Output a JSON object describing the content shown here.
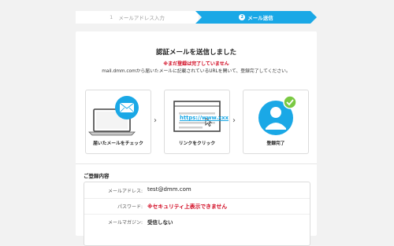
{
  "stepper": {
    "step1_number": "1",
    "step1_label": "メールアドレス入力",
    "step2_number": "2",
    "step2_label": "メール送信"
  },
  "main": {
    "title": "認証メールを送信しました",
    "warning": "※まだ登録は完了していません",
    "description": "mail.dmm.comから届いたメールに記載されているURLを開いて、登録完了してください。"
  },
  "steps": [
    {
      "caption": "届いたメールをチェック",
      "icon": "laptop-mail-icon"
    },
    {
      "caption": "リンクをクリック",
      "icon": "browser-link-icon",
      "url_text": "https://www.xxx"
    },
    {
      "caption": "登録完了",
      "icon": "user-check-icon"
    }
  ],
  "details": {
    "section_title": "ご登録内容",
    "rows": [
      {
        "label": "メールアドレス:",
        "value": "test@dmm.com"
      },
      {
        "label": "パスワード:",
        "value": "※セキュリティ上表示できません"
      },
      {
        "label": "メールマガジン:",
        "value": "受信しない"
      }
    ]
  },
  "colors": {
    "accent": "#1aa8e6",
    "warning": "#d0021b",
    "check": "#7ac943"
  }
}
